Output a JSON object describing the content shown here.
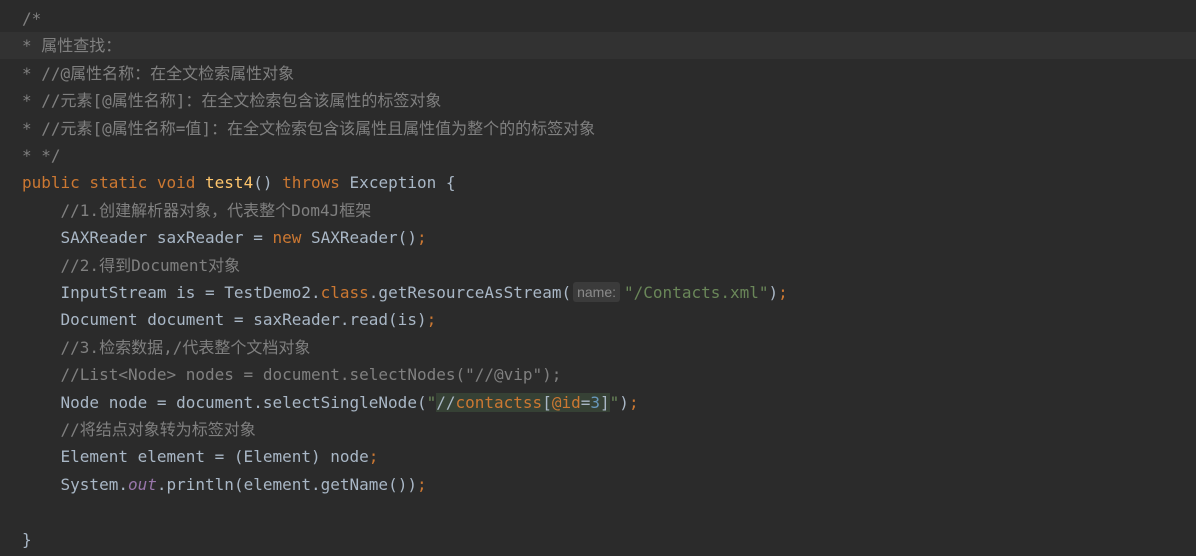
{
  "editor": {
    "lines": [
      {
        "tokens": [
          {
            "text": "/*",
            "type": "comment"
          }
        ]
      },
      {
        "current": true,
        "tokens": [
          {
            "text": "* 属性查找：",
            "type": "comment"
          }
        ]
      },
      {
        "tokens": [
          {
            "text": "* //@属性名称：在全文检索属性对象",
            "type": "comment"
          }
        ]
      },
      {
        "tokens": [
          {
            "text": "* //元素[@属性名称]：在全文检索包含该属性的标签对象",
            "type": "comment"
          }
        ]
      },
      {
        "tokens": [
          {
            "text": "* //元素[@属性名称=值]：在全文检索包含该属性且属性值为整个的的标签对象",
            "type": "comment"
          }
        ]
      },
      {
        "tokens": [
          {
            "text": "* */",
            "type": "comment"
          }
        ]
      },
      {
        "tokens": [
          {
            "text": "public static void ",
            "type": "keyword"
          },
          {
            "text": "test4",
            "type": "method-decl"
          },
          {
            "text": "() ",
            "type": "plain"
          },
          {
            "text": "throws ",
            "type": "keyword"
          },
          {
            "text": "Exception {",
            "type": "plain"
          }
        ]
      },
      {
        "tokens": [
          {
            "text": "    //1.创建解析器对象，代表整个Dom4J框架",
            "type": "comment"
          }
        ]
      },
      {
        "tokens": [
          {
            "text": "    SAXReader saxReader = ",
            "type": "plain"
          },
          {
            "text": "new ",
            "type": "keyword"
          },
          {
            "text": "SAXReader()",
            "type": "plain"
          },
          {
            "text": ";",
            "type": "keyword"
          }
        ]
      },
      {
        "tokens": [
          {
            "text": "    //2.得到Document对象",
            "type": "comment"
          }
        ]
      },
      {
        "tokens": [
          {
            "text": "    InputStream is = TestDemo2.",
            "type": "plain"
          },
          {
            "text": "class",
            "type": "keyword"
          },
          {
            "text": ".getResourceAsStream(",
            "type": "plain"
          },
          {
            "text": "name:",
            "type": "hint"
          },
          {
            "text": "\"/Contacts.xml\"",
            "type": "string"
          },
          {
            "text": ")",
            "type": "plain"
          },
          {
            "text": ";",
            "type": "keyword"
          }
        ]
      },
      {
        "tokens": [
          {
            "text": "    Document document = saxReader.read(is)",
            "type": "plain"
          },
          {
            "text": ";",
            "type": "keyword"
          }
        ]
      },
      {
        "tokens": [
          {
            "text": "    //3.检索数据,/代表整个文档对象",
            "type": "comment"
          }
        ]
      },
      {
        "tokens": [
          {
            "text": "    //List<Node> nodes = document.selectNodes(\"//@vip\");",
            "type": "comment"
          }
        ]
      },
      {
        "tokens": [
          {
            "text": "    Node node = document.selectSingleNode(",
            "type": "plain"
          },
          {
            "text": "\"",
            "type": "string"
          },
          {
            "text": "//",
            "type": "plain",
            "inj": true
          },
          {
            "text": "contactss",
            "type": "regex",
            "inj": true
          },
          {
            "text": "[",
            "type": "plain",
            "inj": true
          },
          {
            "text": "@id",
            "type": "regex",
            "inj": true
          },
          {
            "text": "=",
            "type": "plain",
            "inj": true
          },
          {
            "text": "3",
            "type": "number",
            "inj": true
          },
          {
            "text": "]",
            "type": "plain",
            "inj": true
          },
          {
            "text": "\"",
            "type": "string"
          },
          {
            "text": ")",
            "type": "plain"
          },
          {
            "text": ";",
            "type": "keyword"
          }
        ]
      },
      {
        "tokens": [
          {
            "text": "    //将结点对象转为标签对象",
            "type": "comment"
          }
        ]
      },
      {
        "tokens": [
          {
            "text": "    Element element = (Element) node",
            "type": "plain"
          },
          {
            "text": ";",
            "type": "keyword"
          }
        ]
      },
      {
        "tokens": [
          {
            "text": "    System.",
            "type": "plain"
          },
          {
            "text": "out",
            "type": "field"
          },
          {
            "text": ".println(element.getName())",
            "type": "plain"
          },
          {
            "text": ";",
            "type": "keyword"
          }
        ]
      },
      {
        "tokens": []
      },
      {
        "tokens": [
          {
            "text": "}",
            "type": "plain"
          }
        ]
      }
    ]
  },
  "colors": {
    "background": "#2b2b2b",
    "current_line": "#323232",
    "comment": "#808080",
    "keyword": "#cc7832",
    "method_decl": "#ffc66d",
    "string": "#6a8759",
    "plain": "#a9b7c6",
    "field": "#9876aa",
    "number": "#6897bb",
    "injection_bg": "#364135"
  }
}
